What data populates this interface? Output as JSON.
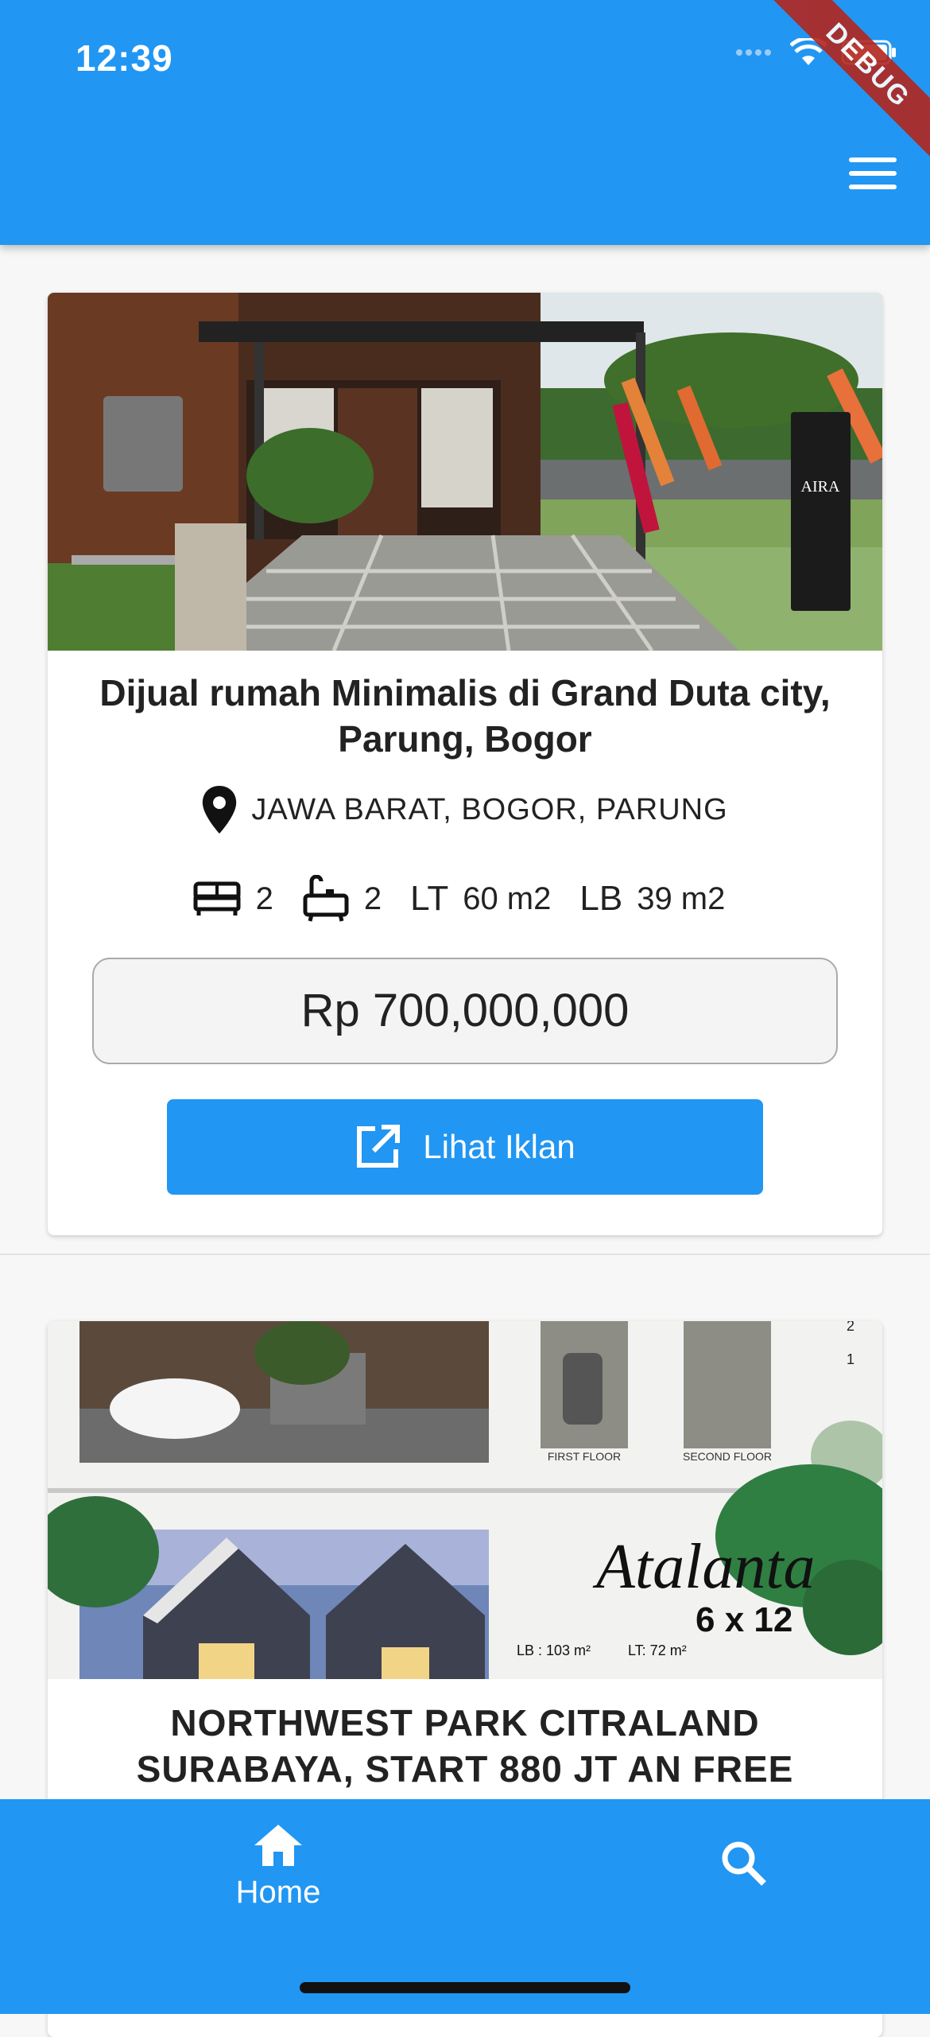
{
  "status_bar": {
    "time": "12:39",
    "debug_label": "DEBUG"
  },
  "app_bar": {
    "menu_icon": "hamburger-menu-icon"
  },
  "listings": [
    {
      "title": "Dijual rumah Minimalis di Grand Duta city, Parung, Bogor",
      "location": "JAWA BARAT, BOGOR, PARUNG",
      "bedrooms": "2",
      "bathrooms": "2",
      "lt_label": "LT",
      "lt_value": "60 m2",
      "lb_label": "LB",
      "lb_value": "39 m2",
      "price": "Rp 700,000,000",
      "cta_label": "Lihat Iklan",
      "photo_sign_text": "AIRA"
    },
    {
      "title": "NORTHWEST PARK CITRALAND SURABAYA, START  880 JT AN FREE",
      "photo_text": {
        "brand": "Atalanta",
        "size": "6 x 12",
        "lb": "LB  : 103 m²",
        "lt": "LT: 72 m²",
        "first_floor": "FIRST FLOOR",
        "second_floor": "SECOND FLOOR",
        "count_a": "2",
        "count_b": "1"
      }
    }
  ],
  "bottom_nav": {
    "home_label": "Home"
  },
  "colors": {
    "primary": "#2196f3",
    "debug": "#b3261e"
  }
}
